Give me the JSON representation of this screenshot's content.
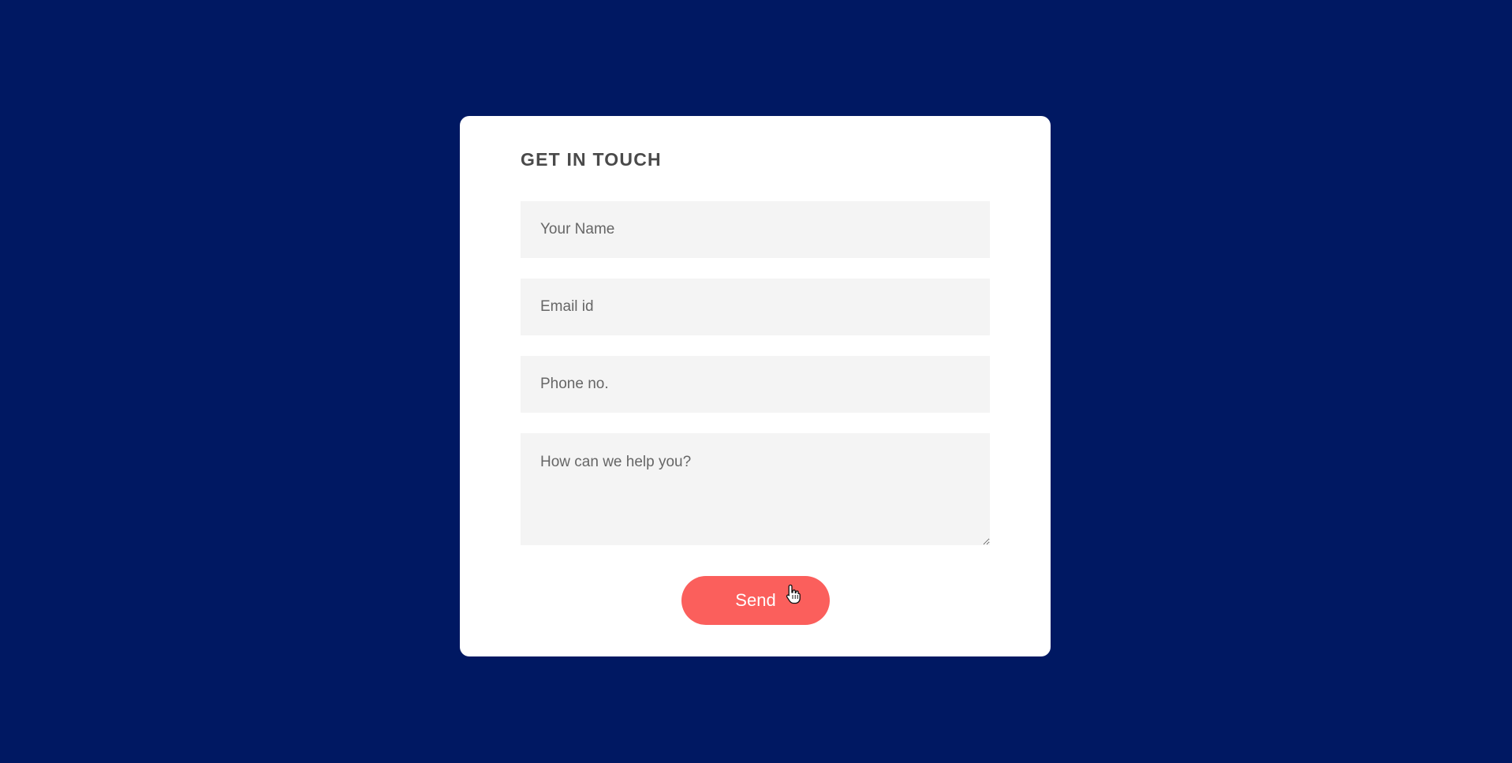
{
  "colors": {
    "background": "#001862",
    "card": "#ffffff",
    "field_background": "#f4f4f4",
    "accent": "#fb5f5c",
    "title_text": "#4a4a4a"
  },
  "form": {
    "title": "GET IN TOUCH",
    "name_placeholder": "Your Name",
    "email_placeholder": "Email id",
    "phone_placeholder": "Phone no.",
    "message_placeholder": "How can we help you?",
    "send_label": "Send"
  },
  "cursor": {
    "icon": "hand-pointer-icon"
  }
}
